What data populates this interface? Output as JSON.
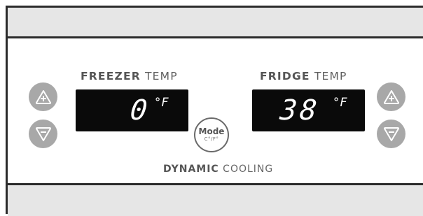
{
  "freezer": {
    "label_bold": "FREEZER",
    "label_light": "TEMP",
    "value": "0",
    "unit": "°F"
  },
  "fridge": {
    "label_bold": "FRIDGE",
    "label_light": "TEMP",
    "value": "38",
    "unit": "°F"
  },
  "mode_button": {
    "label": "Mode",
    "sub_label": "C°/F°"
  },
  "cooling": {
    "label_bold": "DYNAMIC",
    "label_light": "COOLING"
  },
  "icons": {
    "increase": "plus-triangle-icon",
    "decrease": "minus-triangle-icon"
  },
  "colors": {
    "display_bg": "#0a0a0a",
    "display_digits": "#ffffff",
    "button_fill": "#a8a8a8",
    "band_fill": "#e6e6e6"
  }
}
